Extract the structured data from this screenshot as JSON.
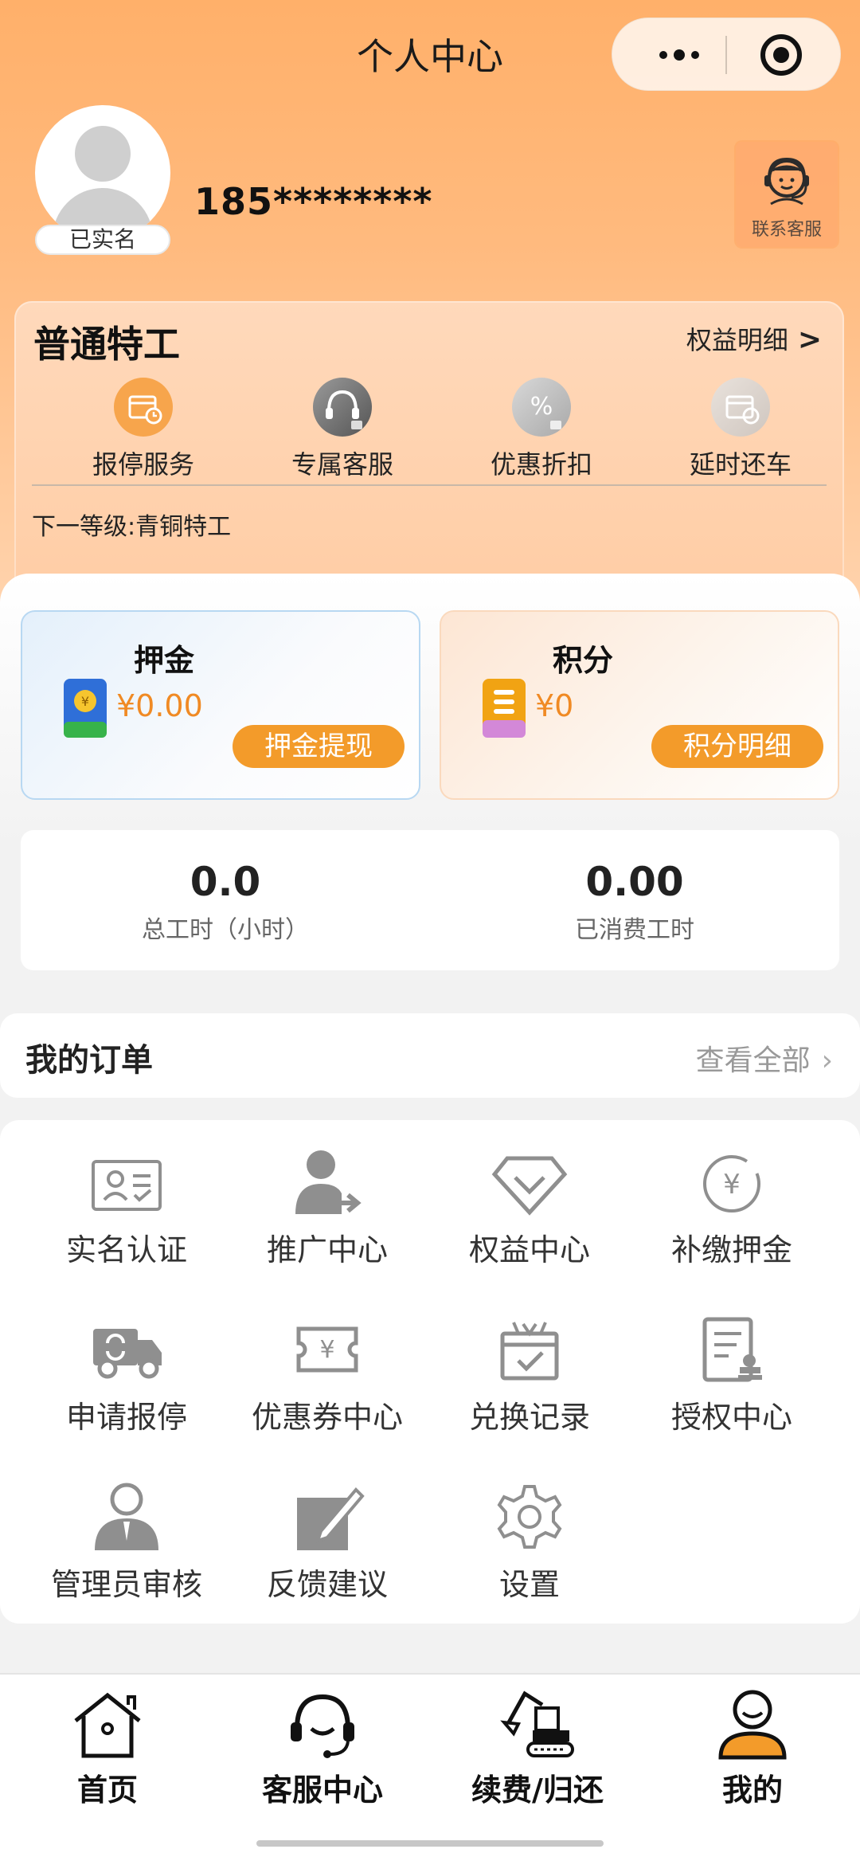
{
  "app": {
    "title": "个人中心",
    "capsule": {
      "more_icon": "more-dots-icon",
      "close_icon": "target-icon"
    }
  },
  "profile": {
    "verified_label": "已实名",
    "phone": "185********",
    "customer_service_label": "联系客服"
  },
  "level": {
    "name": "普通特工",
    "rights_link": "权益明细",
    "next_level": "下一等级:青铜特工",
    "perks": [
      {
        "label": "报停服务",
        "icon": "pause-service-icon"
      },
      {
        "label": "专属客服",
        "icon": "headset-icon"
      },
      {
        "label": "优惠折扣",
        "icon": "discount-icon"
      },
      {
        "label": "延时还车",
        "icon": "delay-return-icon"
      }
    ]
  },
  "wallet": {
    "deposit": {
      "title": "押金",
      "amount": "¥0.00",
      "action": "押金提现"
    },
    "points": {
      "title": "积分",
      "amount": "¥0",
      "action": "积分明细"
    }
  },
  "hours": {
    "total": {
      "value": "0.0",
      "label": "总工时（小时）"
    },
    "consumed": {
      "value": "0.00",
      "label": "已消费工时"
    }
  },
  "orders": {
    "title": "我的订单",
    "view_all": "查看全部"
  },
  "services": [
    {
      "label": "实名认证",
      "icon": "id-card-icon"
    },
    {
      "label": "推广中心",
      "icon": "referral-user-icon"
    },
    {
      "label": "权益中心",
      "icon": "diamond-icon"
    },
    {
      "label": "补缴押金",
      "icon": "yuan-coin-icon"
    },
    {
      "label": "申请报停",
      "icon": "truck-icon"
    },
    {
      "label": "优惠券中心",
      "icon": "coupon-icon"
    },
    {
      "label": "兑换记录",
      "icon": "gift-icon"
    },
    {
      "label": "授权中心",
      "icon": "authorization-icon"
    },
    {
      "label": "管理员审核",
      "icon": "admin-icon"
    },
    {
      "label": "反馈建议",
      "icon": "feedback-icon"
    },
    {
      "label": "设置",
      "icon": "gear-icon"
    }
  ],
  "tabbar": [
    {
      "label": "首页",
      "icon": "home-icon"
    },
    {
      "label": "客服中心",
      "icon": "headset-icon"
    },
    {
      "label": "续费/归还",
      "icon": "excavator-icon"
    },
    {
      "label": "我的",
      "icon": "user-icon",
      "active": true
    }
  ],
  "colors": {
    "header_orange": "#ffb06a",
    "accent_orange": "#f39b2a",
    "amount_orange": "#f08a24",
    "icon_gray": "#8f8f8f"
  }
}
